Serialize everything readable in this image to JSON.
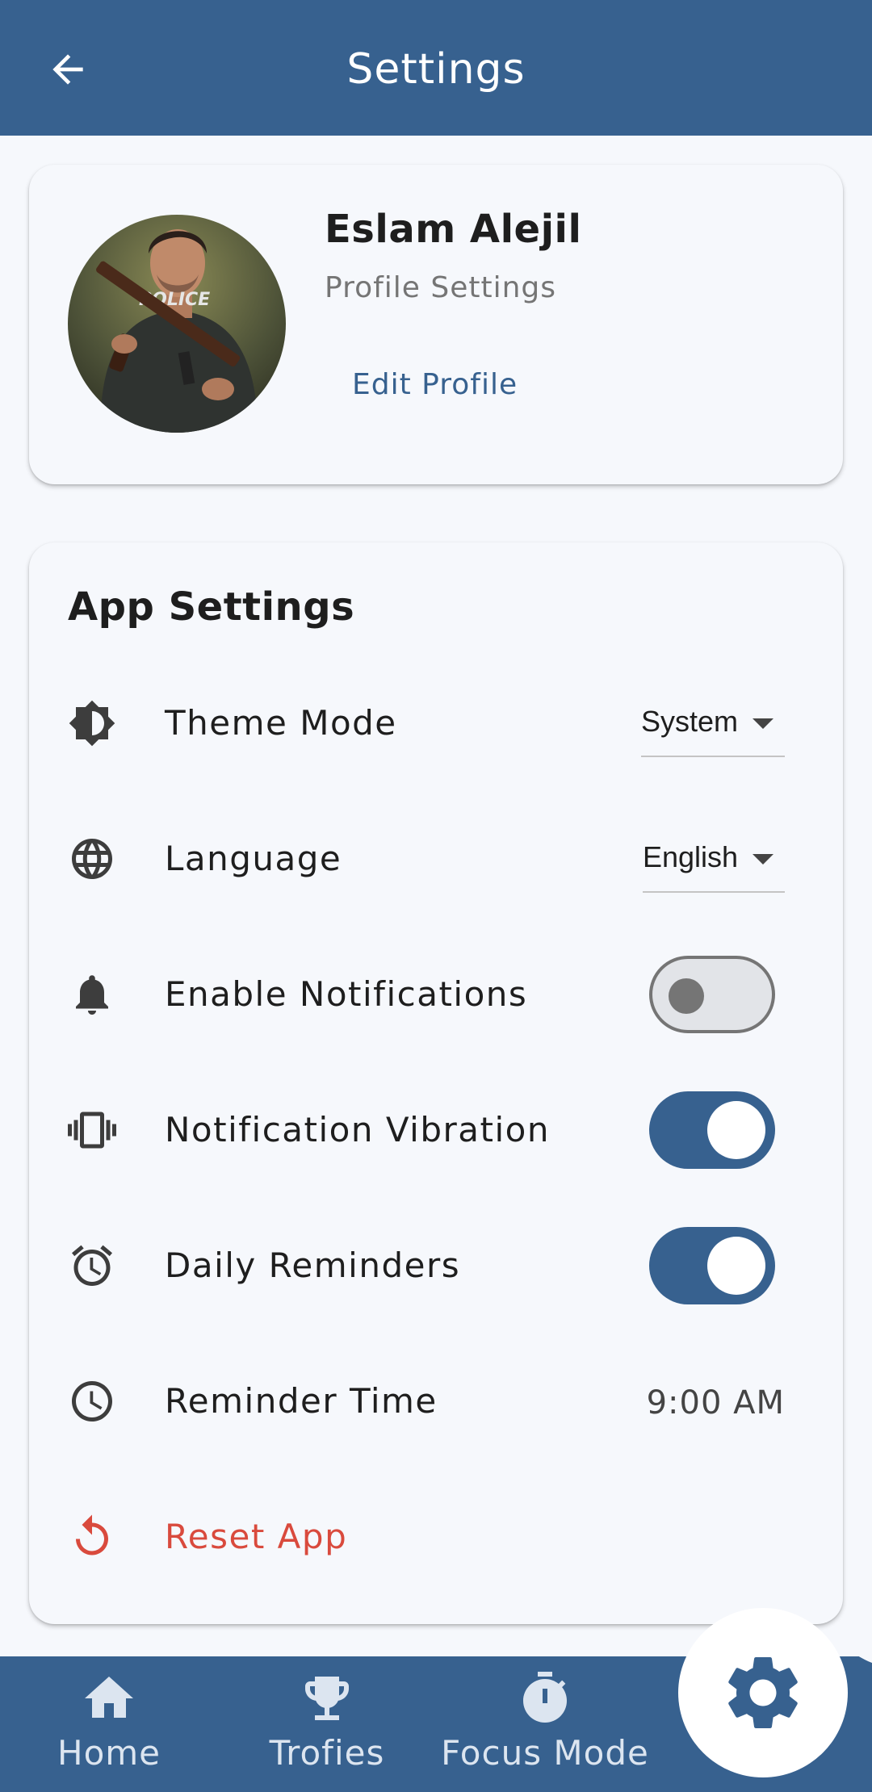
{
  "appbar": {
    "title": "Settings"
  },
  "profile": {
    "name": "Eslam Alejil",
    "subtitle": "Profile Settings",
    "edit_label": "Edit Profile",
    "avatar_badge_text": "POLICE"
  },
  "app_settings": {
    "title": "App Settings",
    "rows": [
      {
        "icon": "brightness-contrast-icon",
        "label": "Theme Mode",
        "control": "dropdown",
        "value": "System"
      },
      {
        "icon": "globe-icon",
        "label": "Language",
        "control": "dropdown",
        "value": "English"
      },
      {
        "icon": "bell-icon",
        "label": "Enable Notifications",
        "control": "toggle",
        "on": false
      },
      {
        "icon": "vibration-icon",
        "label": "Notification Vibration",
        "control": "toggle",
        "on": true
      },
      {
        "icon": "alarm-clock-icon",
        "label": "Daily Reminders",
        "control": "toggle",
        "on": true
      },
      {
        "icon": "clock-icon",
        "label": "Reminder Time",
        "control": "value",
        "value": "9:00 AM"
      },
      {
        "icon": "reset-icon",
        "label": "Reset App",
        "control": "none",
        "danger": true
      }
    ]
  },
  "bottom_nav": {
    "items": [
      {
        "icon": "home-icon",
        "label": "Home"
      },
      {
        "icon": "trophy-icon",
        "label": "Trofies"
      },
      {
        "icon": "stopwatch-icon",
        "label": "Focus Mode"
      }
    ],
    "active": {
      "icon": "gear-icon"
    }
  },
  "colors": {
    "primary": "#37618F",
    "background": "#F6F8FC",
    "danger": "#D94A3D"
  }
}
